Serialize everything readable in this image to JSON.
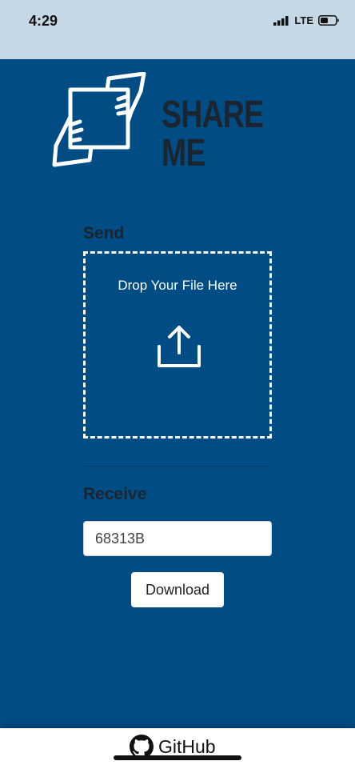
{
  "status_bar": {
    "time": "4:29",
    "network": "LTE",
    "icons": [
      "signal-icon",
      "battery-icon"
    ]
  },
  "header": {
    "logo_icon": "hands-exchange-icon",
    "title": "SHARE ME"
  },
  "send": {
    "heading": "Send",
    "drop_text": "Drop Your File Here",
    "icon": "upload-icon"
  },
  "receive": {
    "heading": "Receive",
    "code_value": "68313B",
    "download_label": "Download"
  },
  "footer": {
    "icon": "github-icon",
    "link_label": "GitHub"
  },
  "colors": {
    "background": "#004c84",
    "status_bar": "#c5d8e6",
    "title": "#1a2530",
    "white": "#ffffff"
  }
}
